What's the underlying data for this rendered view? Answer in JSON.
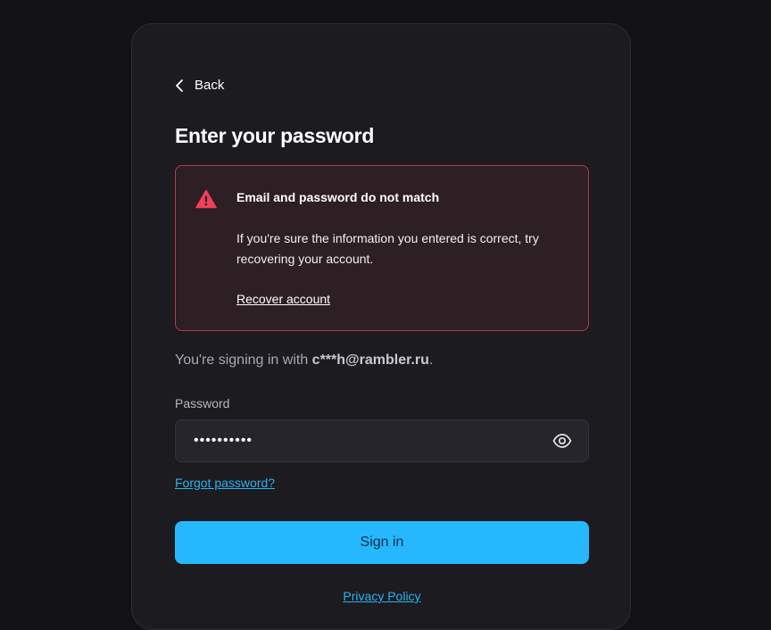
{
  "nav": {
    "back_label": "Back"
  },
  "page": {
    "title": "Enter your password"
  },
  "alert": {
    "title": "Email and password do not match",
    "body": "If you're sure the information you entered is correct, try recovering your account.",
    "link_label": "Recover account",
    "icon": "warning-triangle-icon"
  },
  "signing": {
    "prefix": "You're signing in with ",
    "email": "c***h@rambler.ru",
    "suffix": "."
  },
  "password": {
    "label": "Password",
    "value": "••••••••••",
    "toggle_icon": "eye-icon"
  },
  "links": {
    "forgot": "Forgot password?",
    "privacy": "Privacy Policy"
  },
  "actions": {
    "signin_label": "Sign in"
  },
  "colors": {
    "accent": "#26b8ff",
    "link": "#2ab4f0",
    "error_border": "#b3384f",
    "error_icon": "#f0415a",
    "card_bg": "#1b1b20",
    "page_bg": "#121214"
  }
}
